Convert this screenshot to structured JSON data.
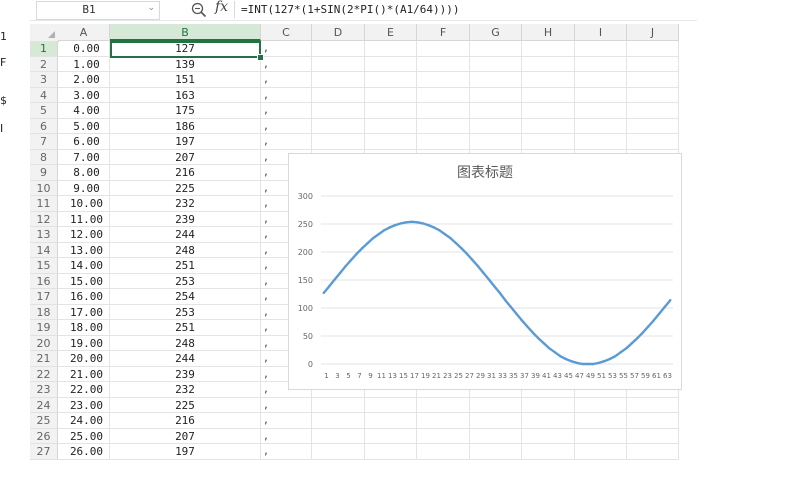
{
  "edge_chars": [
    "1",
    "F",
    "$",
    "I"
  ],
  "name_box": {
    "value": "B1"
  },
  "formula_bar": {
    "formula": "=INT(127*(1+SIN(2*PI()*(A1/64))))"
  },
  "columns": [
    "A",
    "B",
    "C",
    "D",
    "E",
    "F",
    "G",
    "H",
    "I",
    "J"
  ],
  "selected_column": "B",
  "rows": [
    {
      "n": "1",
      "a": "0.00",
      "b": "127",
      "c": ","
    },
    {
      "n": "2",
      "a": "1.00",
      "b": "139",
      "c": ","
    },
    {
      "n": "3",
      "a": "2.00",
      "b": "151",
      "c": ","
    },
    {
      "n": "4",
      "a": "3.00",
      "b": "163",
      "c": ","
    },
    {
      "n": "5",
      "a": "4.00",
      "b": "175",
      "c": ","
    },
    {
      "n": "6",
      "a": "5.00",
      "b": "186",
      "c": ","
    },
    {
      "n": "7",
      "a": "6.00",
      "b": "197",
      "c": ","
    },
    {
      "n": "8",
      "a": "7.00",
      "b": "207",
      "c": ","
    },
    {
      "n": "9",
      "a": "8.00",
      "b": "216",
      "c": ","
    },
    {
      "n": "10",
      "a": "9.00",
      "b": "225",
      "c": ","
    },
    {
      "n": "11",
      "a": "10.00",
      "b": "232",
      "c": ","
    },
    {
      "n": "12",
      "a": "11.00",
      "b": "239",
      "c": ","
    },
    {
      "n": "13",
      "a": "12.00",
      "b": "244",
      "c": ","
    },
    {
      "n": "14",
      "a": "13.00",
      "b": "248",
      "c": ","
    },
    {
      "n": "15",
      "a": "14.00",
      "b": "251",
      "c": ","
    },
    {
      "n": "16",
      "a": "15.00",
      "b": "253",
      "c": ","
    },
    {
      "n": "17",
      "a": "16.00",
      "b": "254",
      "c": ","
    },
    {
      "n": "18",
      "a": "17.00",
      "b": "253",
      "c": ","
    },
    {
      "n": "19",
      "a": "18.00",
      "b": "251",
      "c": ","
    },
    {
      "n": "20",
      "a": "19.00",
      "b": "248",
      "c": ","
    },
    {
      "n": "21",
      "a": "20.00",
      "b": "244",
      "c": ","
    },
    {
      "n": "22",
      "a": "21.00",
      "b": "239",
      "c": ","
    },
    {
      "n": "23",
      "a": "22.00",
      "b": "232",
      "c": ","
    },
    {
      "n": "24",
      "a": "23.00",
      "b": "225",
      "c": ","
    },
    {
      "n": "25",
      "a": "24.00",
      "b": "216",
      "c": ","
    },
    {
      "n": "26",
      "a": "25.00",
      "b": "207",
      "c": ","
    },
    {
      "n": "27",
      "a": "26.00",
      "b": "197",
      "c": ","
    }
  ],
  "colors": {
    "accent": "#217346",
    "series": "#5b9bd5"
  },
  "chart_data": {
    "type": "line",
    "title": "图表标题",
    "xlabel": "",
    "ylabel": "",
    "ylim": [
      0,
      300
    ],
    "yticks": [
      0,
      50,
      100,
      150,
      200,
      250,
      300
    ],
    "xticks": [
      "1",
      "3",
      "5",
      "7",
      "9",
      "11",
      "13",
      "15",
      "17",
      "19",
      "21",
      "23",
      "25",
      "27",
      "29",
      "31",
      "33",
      "35",
      "37",
      "39",
      "41",
      "43",
      "45",
      "47",
      "49",
      "51",
      "53",
      "55",
      "57",
      "59",
      "61",
      "63"
    ],
    "grid": true,
    "legend": "none",
    "series": [
      {
        "values": [
          127,
          139,
          151,
          163,
          175,
          186,
          197,
          207,
          216,
          225,
          232,
          239,
          244,
          248,
          251,
          253,
          254,
          253,
          251,
          248,
          244,
          239,
          232,
          225,
          216,
          207,
          197,
          186,
          175,
          163,
          151,
          139,
          127,
          114,
          102,
          90,
          78,
          67,
          56,
          46,
          37,
          28,
          21,
          14,
          9,
          5,
          2,
          0,
          0,
          0,
          2,
          5,
          9,
          14,
          21,
          28,
          37,
          46,
          56,
          67,
          78,
          90,
          102,
          114
        ]
      }
    ]
  }
}
